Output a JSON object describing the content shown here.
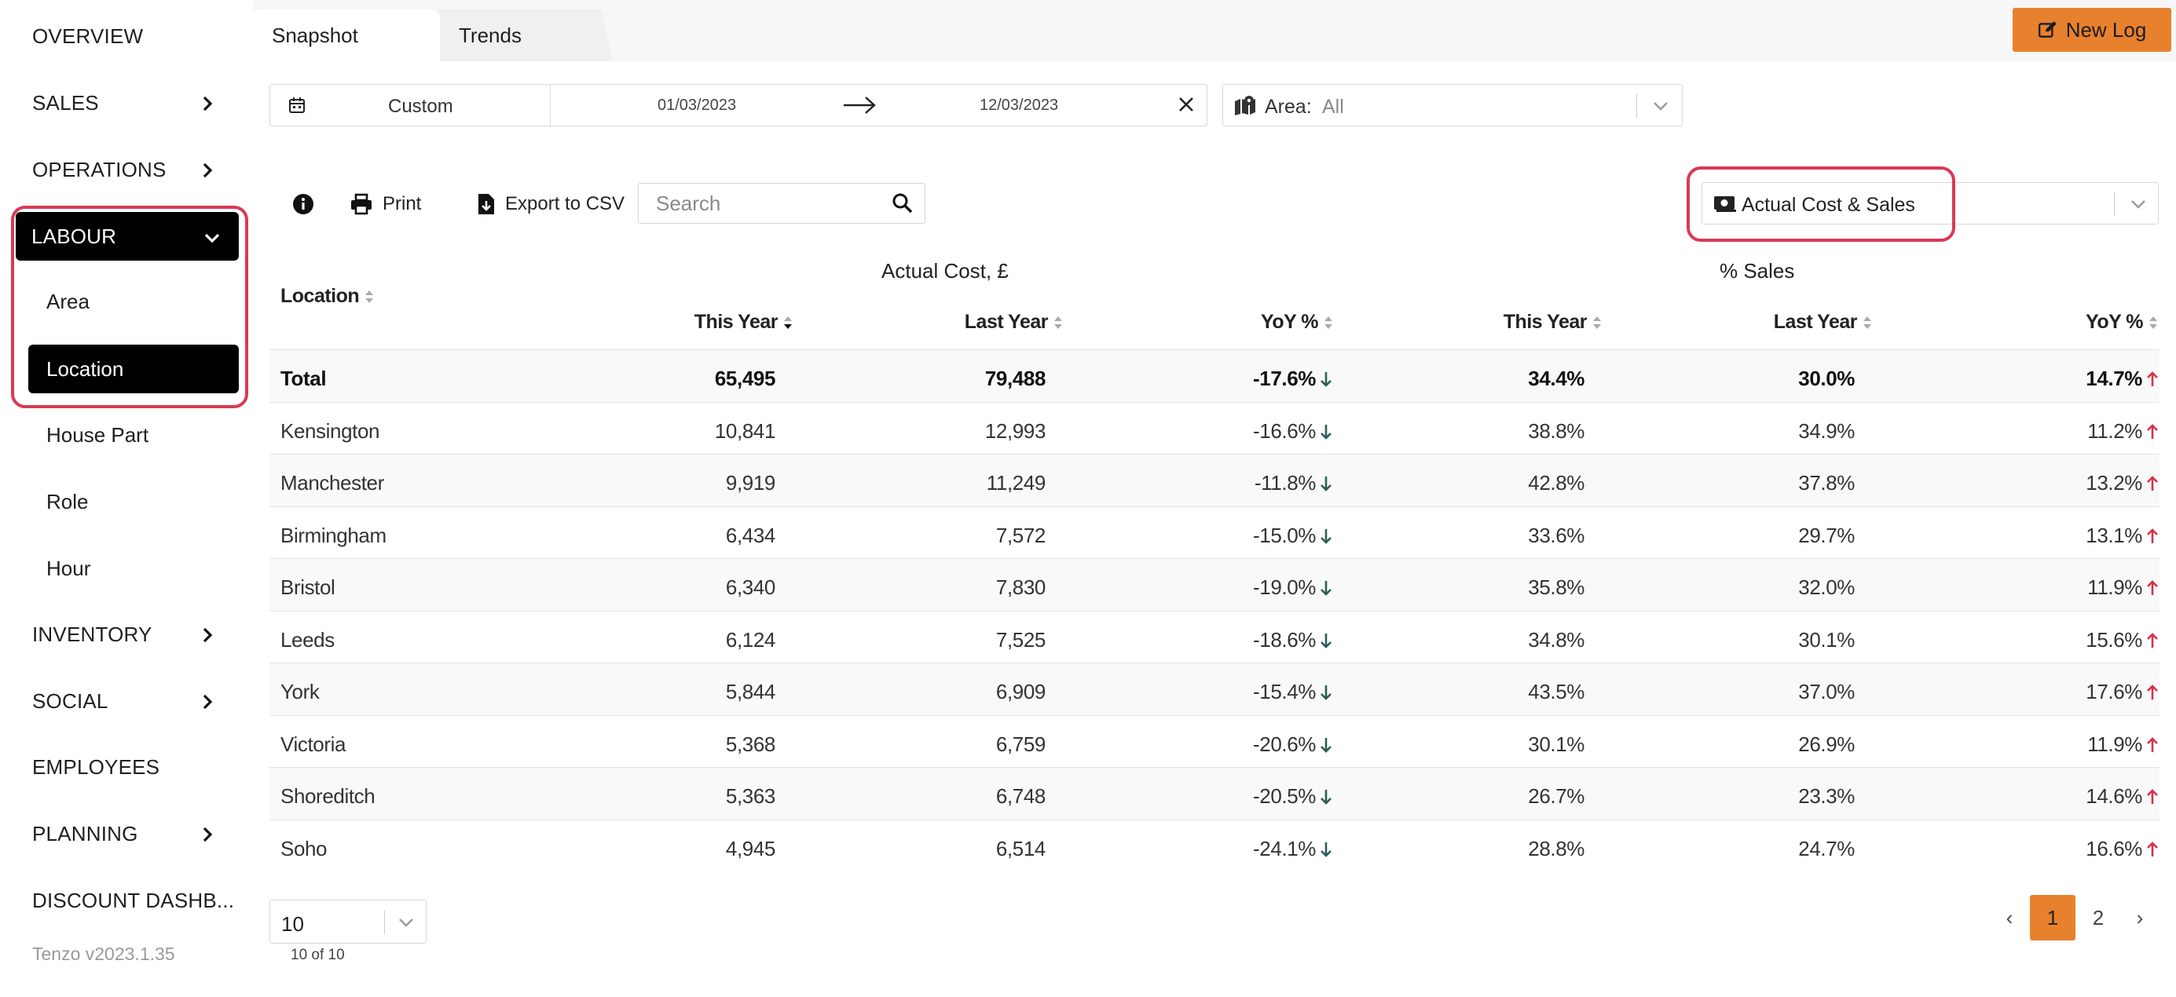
{
  "sidebar": {
    "items": [
      {
        "label": "OVERVIEW"
      },
      {
        "label": "SALES"
      },
      {
        "label": "OPERATIONS"
      },
      {
        "label": "LABOUR"
      },
      {
        "label": "INVENTORY"
      },
      {
        "label": "SOCIAL"
      },
      {
        "label": "EMPLOYEES"
      },
      {
        "label": "PLANNING"
      },
      {
        "label": "DISCOUNT DASHB..."
      }
    ],
    "labour_sub": [
      {
        "label": "Area"
      },
      {
        "label": "Location"
      },
      {
        "label": "House Part"
      },
      {
        "label": "Role"
      },
      {
        "label": "Hour"
      }
    ],
    "version": "Tenzo v2023.1.35"
  },
  "tabs": [
    {
      "label": "Snapshot"
    },
    {
      "label": "Trends"
    }
  ],
  "new_log_label": "New Log",
  "filters": {
    "date_preset": "Custom",
    "date_from": "01/03/2023",
    "date_to": "12/03/2023",
    "area_label": "Area:",
    "area_value": "All"
  },
  "toolbar": {
    "print_label": "Print",
    "export_label": "Export to CSV",
    "search_placeholder": "Search",
    "metric_value": "Actual Cost & Sales"
  },
  "table": {
    "location_header": "Location",
    "group1": "Actual Cost, £",
    "group2": "% Sales",
    "columns": [
      "This Year",
      "Last Year",
      "YoY %",
      "This Year",
      "Last Year",
      "YoY %"
    ],
    "rows": [
      {
        "loc": "Total",
        "ty": "65,495",
        "ly": "79,488",
        "yoy": "-17.6%",
        "sty": "34.4%",
        "sly": "30.0%",
        "syoy": "14.7%"
      },
      {
        "loc": "Kensington",
        "ty": "10,841",
        "ly": "12,993",
        "yoy": "-16.6%",
        "sty": "38.8%",
        "sly": "34.9%",
        "syoy": "11.2%"
      },
      {
        "loc": "Manchester",
        "ty": "9,919",
        "ly": "11,249",
        "yoy": "-11.8%",
        "sty": "42.8%",
        "sly": "37.8%",
        "syoy": "13.2%"
      },
      {
        "loc": "Birmingham",
        "ty": "6,434",
        "ly": "7,572",
        "yoy": "-15.0%",
        "sty": "33.6%",
        "sly": "29.7%",
        "syoy": "13.1%"
      },
      {
        "loc": "Bristol",
        "ty": "6,340",
        "ly": "7,830",
        "yoy": "-19.0%",
        "sty": "35.8%",
        "sly": "32.0%",
        "syoy": "11.9%"
      },
      {
        "loc": "Leeds",
        "ty": "6,124",
        "ly": "7,525",
        "yoy": "-18.6%",
        "sty": "34.8%",
        "sly": "30.1%",
        "syoy": "15.6%"
      },
      {
        "loc": "York",
        "ty": "5,844",
        "ly": "6,909",
        "yoy": "-15.4%",
        "sty": "43.5%",
        "sly": "37.0%",
        "syoy": "17.6%"
      },
      {
        "loc": "Victoria",
        "ty": "5,368",
        "ly": "6,759",
        "yoy": "-20.6%",
        "sty": "30.1%",
        "sly": "26.9%",
        "syoy": "11.9%"
      },
      {
        "loc": "Shoreditch",
        "ty": "5,363",
        "ly": "6,748",
        "yoy": "-20.5%",
        "sty": "26.7%",
        "sly": "23.3%",
        "syoy": "14.6%"
      },
      {
        "loc": "Soho",
        "ty": "4,945",
        "ly": "6,514",
        "yoy": "-24.1%",
        "sty": "28.8%",
        "sly": "24.7%",
        "syoy": "16.6%"
      }
    ]
  },
  "pagination": {
    "page_size": "10",
    "count_text": "10 of 10",
    "prev": "‹",
    "pages": [
      "1",
      "2"
    ],
    "next": "›"
  },
  "colors": {
    "accent": "#e8812e",
    "highlight": "#d93a55",
    "down_arrow": "#2f5d57",
    "up_arrow": "#d6324a"
  }
}
